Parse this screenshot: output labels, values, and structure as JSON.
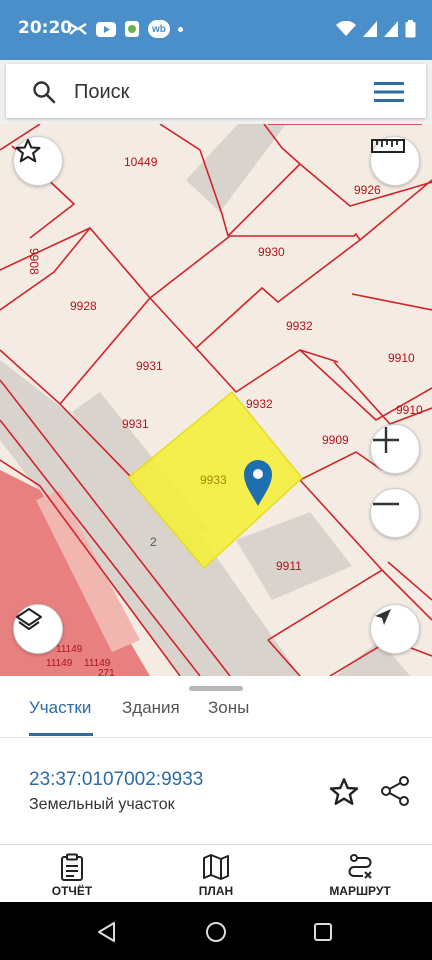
{
  "status_bar": {
    "time": "20:20",
    "left_icons": [
      "inbox-icon",
      "youtube-icon",
      "app-icon",
      "wb-icon",
      "dot"
    ],
    "wb_label": "wb",
    "right_icons": [
      "wifi-icon",
      "signal-icon",
      "signal-icon",
      "battery-icon"
    ]
  },
  "search": {
    "placeholder": "Поиск"
  },
  "map": {
    "parcel_labels": [
      "10449",
      "9926",
      "9908",
      "9930",
      "9928",
      "9932",
      "9910",
      "9931",
      "9932",
      "9910",
      "9931",
      "9909",
      "9933",
      "2",
      "9911",
      "11149",
      "11149",
      "11149",
      "271"
    ],
    "selected_parcel": "9933",
    "colors": {
      "background": "#f4ece3",
      "building": "#d8d3cc",
      "border": "#d2232a",
      "selected": "#f5f033",
      "marker": "#1e6fb0",
      "pink_zone": "#e88080"
    }
  },
  "tabs": {
    "items": [
      "Участки",
      "Здания",
      "Зоны"
    ],
    "active": "Участки"
  },
  "parcel": {
    "cadastral_number": "23:37:0107002:9933",
    "type": "Земельный участок"
  },
  "actions": {
    "report": "ОТЧЁТ",
    "plan": "ПЛАН",
    "route": "МАРШРУТ"
  }
}
